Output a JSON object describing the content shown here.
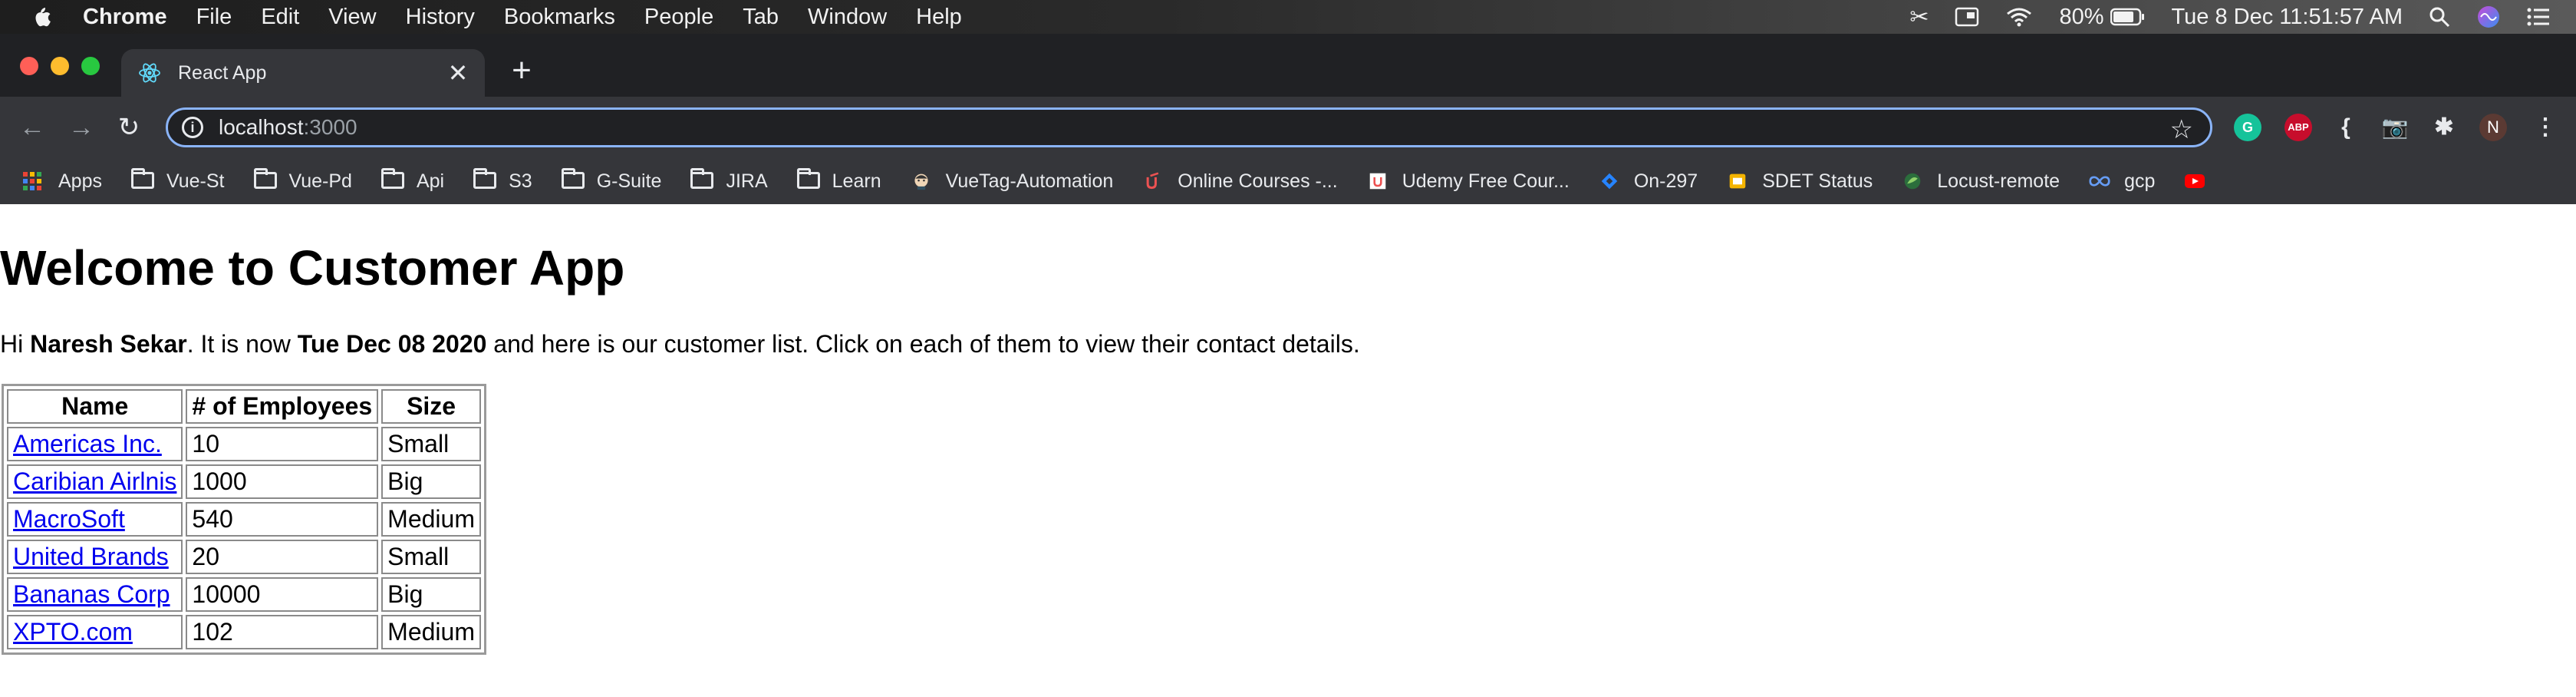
{
  "menubar": {
    "app_name": "Chrome",
    "items": [
      "File",
      "Edit",
      "View",
      "History",
      "Bookmarks",
      "People",
      "Tab",
      "Window",
      "Help"
    ],
    "battery": "80%",
    "datetime": "Tue 8 Dec  11:51:57 AM"
  },
  "tab": {
    "title": "React App",
    "close_glyph": "✕",
    "new_tab_glyph": "+"
  },
  "toolbar": {
    "url_host": "localhost",
    "url_port": ":3000",
    "profile_initial": "N",
    "abp_label": "ABP",
    "grammarly_label": "G"
  },
  "bookmarks": [
    {
      "label": "Apps",
      "icon": "apps-grid-icon"
    },
    {
      "label": "Vue-St",
      "icon": "folder-icon"
    },
    {
      "label": "Vue-Pd",
      "icon": "folder-icon"
    },
    {
      "label": "Api",
      "icon": "folder-icon"
    },
    {
      "label": "S3",
      "icon": "folder-icon"
    },
    {
      "label": "G-Suite",
      "icon": "folder-icon"
    },
    {
      "label": "JIRA",
      "icon": "folder-icon"
    },
    {
      "label": "Learn",
      "icon": "folder-icon"
    },
    {
      "label": "VueTag-Automation",
      "icon": "jenkins-icon"
    },
    {
      "label": "Online Courses -...",
      "icon": "udemy-icon"
    },
    {
      "label": "Udemy Free Cour...",
      "icon": "udemy-square-icon"
    },
    {
      "label": "On-297",
      "icon": "jira-diamond-icon"
    },
    {
      "label": "SDET Status",
      "icon": "slides-icon"
    },
    {
      "label": "Locust-remote",
      "icon": "locust-icon"
    },
    {
      "label": "gcp",
      "icon": "infinity-icon"
    },
    {
      "label": "",
      "icon": "youtube-icon"
    }
  ],
  "page": {
    "title": "Welcome to Customer App",
    "intro_prefix": "Hi ",
    "user_name": "Naresh Sekar",
    "intro_middle": ". It is now ",
    "date": "Tue Dec 08 2020",
    "intro_suffix": " and here is our customer list. Click on each of them to view their contact details."
  },
  "table": {
    "headers": [
      "Name",
      "# of Employees",
      "Size"
    ],
    "rows": [
      {
        "name": "Americas Inc.",
        "employees": "10",
        "size": "Small"
      },
      {
        "name": "Caribian Airlnis",
        "employees": "1000",
        "size": "Big"
      },
      {
        "name": "MacroSoft",
        "employees": "540",
        "size": "Medium"
      },
      {
        "name": "United Brands",
        "employees": "20",
        "size": "Small"
      },
      {
        "name": "Bananas Corp",
        "employees": "10000",
        "size": "Big"
      },
      {
        "name": "XPTO.com",
        "employees": "102",
        "size": "Medium"
      }
    ]
  }
}
